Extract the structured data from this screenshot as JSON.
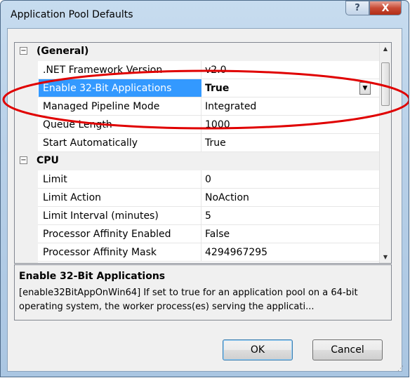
{
  "window": {
    "title": "Application Pool Defaults",
    "help_label": "?",
    "close_label": "X"
  },
  "grid": {
    "categories": [
      {
        "toggle": "⊟",
        "label": "(General)"
      },
      {
        "toggle": "⊟",
        "label": "CPU"
      }
    ],
    "rows": [
      {
        "name": ".NET Framework Version",
        "value": "v2.0"
      },
      {
        "name": "Enable 32-Bit Applications",
        "value": "True",
        "selected": true
      },
      {
        "name": "Managed Pipeline Mode",
        "value": "Integrated"
      },
      {
        "name": "Queue Length",
        "value": "1000"
      },
      {
        "name": "Start Automatically",
        "value": "True"
      },
      {
        "name": "Limit",
        "value": "0"
      },
      {
        "name": "Limit Action",
        "value": "NoAction"
      },
      {
        "name": "Limit Interval (minutes)",
        "value": "5"
      },
      {
        "name": "Processor Affinity Enabled",
        "value": "False"
      },
      {
        "name": "Processor Affinity Mask",
        "value": "4294967295"
      }
    ]
  },
  "description": {
    "title": "Enable 32-Bit Applications",
    "text": "[enable32BitAppOnWin64] If set to true for an application pool on a 64-bit operating system, the worker process(es) serving the applicati..."
  },
  "buttons": {
    "ok": "OK",
    "cancel": "Cancel"
  },
  "colors": {
    "selection": "#3399ff",
    "annotation": "#e00000",
    "close": "#c84b35"
  },
  "icons": [
    "help-icon",
    "close-icon",
    "dropdown-arrow-icon",
    "scroll-up-icon",
    "scroll-down-icon",
    "collapse-icon"
  ]
}
